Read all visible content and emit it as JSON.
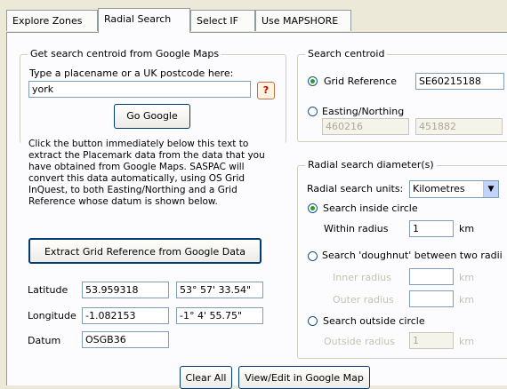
{
  "tabs": [
    "Explore Zones",
    "Radial Search",
    "Select IF",
    "Use MAPSHORE"
  ],
  "google": {
    "legend": "Get search centroid from Google Maps",
    "prompt": "Type a placename or a UK postcode here:",
    "place_value": "york",
    "help_label": "?",
    "go_label": "Go Google",
    "description": "Click the button immediately below this text to extract the Placemark data from the data that you have obtained from Google Maps. SASPAC will convert this data automatically, using OS Grid InQuest, to both Easting/Northing and a Grid Reference whose datum is shown below.",
    "extract_label": "Extract Grid Reference from Google Data",
    "latitude_label": "Latitude",
    "latitude_value": "53.959318",
    "latitude_dms": "53° 57' 33.54\"",
    "longitude_label": "Longitude",
    "longitude_value": "-1.082153",
    "longitude_dms": "-1° 4' 55.75\"",
    "datum_label": "Datum",
    "datum_value": "OSGB36"
  },
  "centroid": {
    "legend": "Search centroid",
    "grid_ref_label": "Grid Reference",
    "grid_ref_value": "SE60215188",
    "easting_label": "Easting/Northing",
    "easting_value": "460216",
    "northing_value": "451882"
  },
  "radial": {
    "legend": "Radial search diameter(s)",
    "units_label": "Radial search units:",
    "units_value": "Kilometres",
    "inside_label": "Search inside circle",
    "within_label": "Within radius",
    "within_value": "1",
    "km": "km",
    "doughnut_label": "Search 'doughnut' between two radii",
    "inner_label": "Inner radius",
    "outer_label": "Outer radius",
    "outside_label": "Search outside circle",
    "outside_radius_label": "Outside radius",
    "outside_value": "1"
  },
  "bottom": {
    "clear_label": "Clear All",
    "view_label": "View/Edit in Google Map"
  }
}
